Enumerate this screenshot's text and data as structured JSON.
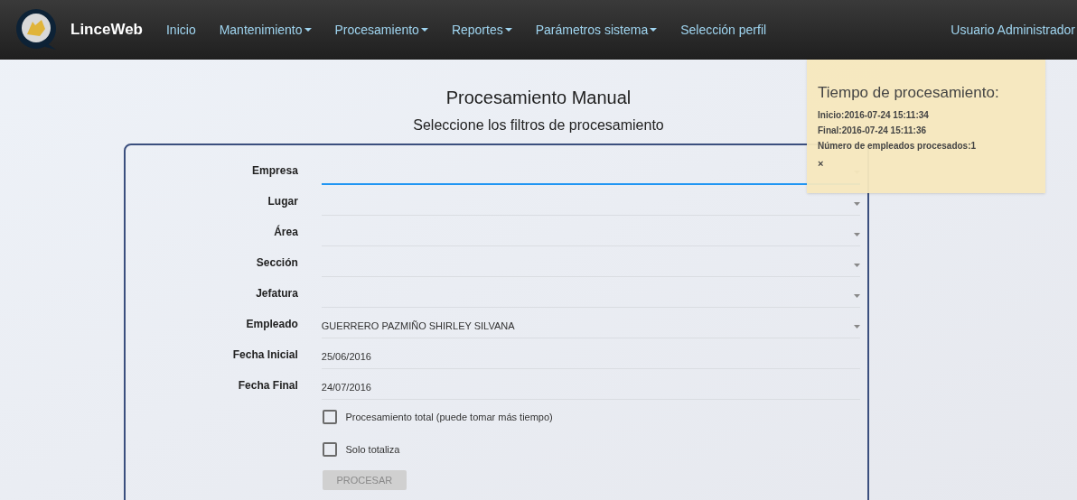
{
  "navbar": {
    "brand": "LinceWeb",
    "items": [
      {
        "label": "Inicio",
        "dropdown": false
      },
      {
        "label": "Mantenimiento",
        "dropdown": true
      },
      {
        "label": "Procesamiento",
        "dropdown": true
      },
      {
        "label": "Reportes",
        "dropdown": true
      },
      {
        "label": "Parámetros sistema",
        "dropdown": true
      },
      {
        "label": "Selección perfil",
        "dropdown": false
      }
    ],
    "user": "Usuario Administrador"
  },
  "page": {
    "title": "Procesamiento Manual",
    "subtitle": "Seleccione los filtros de procesamiento"
  },
  "form": {
    "fields": [
      {
        "label": "Empresa",
        "kind": "select",
        "focused": true
      },
      {
        "label": "Lugar",
        "kind": "select",
        "focused": false
      },
      {
        "label": "Área",
        "kind": "select",
        "focused": false
      },
      {
        "label": "Sección",
        "kind": "select",
        "focused": false
      },
      {
        "label": "Jefatura",
        "kind": "select",
        "focused": false
      },
      {
        "label": "Empleado",
        "kind": "select",
        "value": "GUERRERO PAZMIÑO SHIRLEY SILVANA",
        "focused": false
      },
      {
        "label": "Fecha Inicial",
        "kind": "text",
        "value": "25/06/2016",
        "focused": false
      },
      {
        "label": "Fecha Final",
        "kind": "text",
        "value": "24/07/2016",
        "focused": false
      }
    ],
    "checkboxes": [
      {
        "label": "Procesamiento total (puede tomar más tiempo)",
        "checked": false
      },
      {
        "label": "Solo totaliza",
        "checked": false
      }
    ],
    "button": {
      "label": "PROCESAR",
      "disabled": true
    }
  },
  "toast": {
    "title": "Tiempo de procesamiento:",
    "lines": [
      "Inicio:2016-07-24 15:11:34",
      "Final:2016-07-24 15:11:36",
      "Número de empleados procesados:1"
    ],
    "close": "×"
  }
}
